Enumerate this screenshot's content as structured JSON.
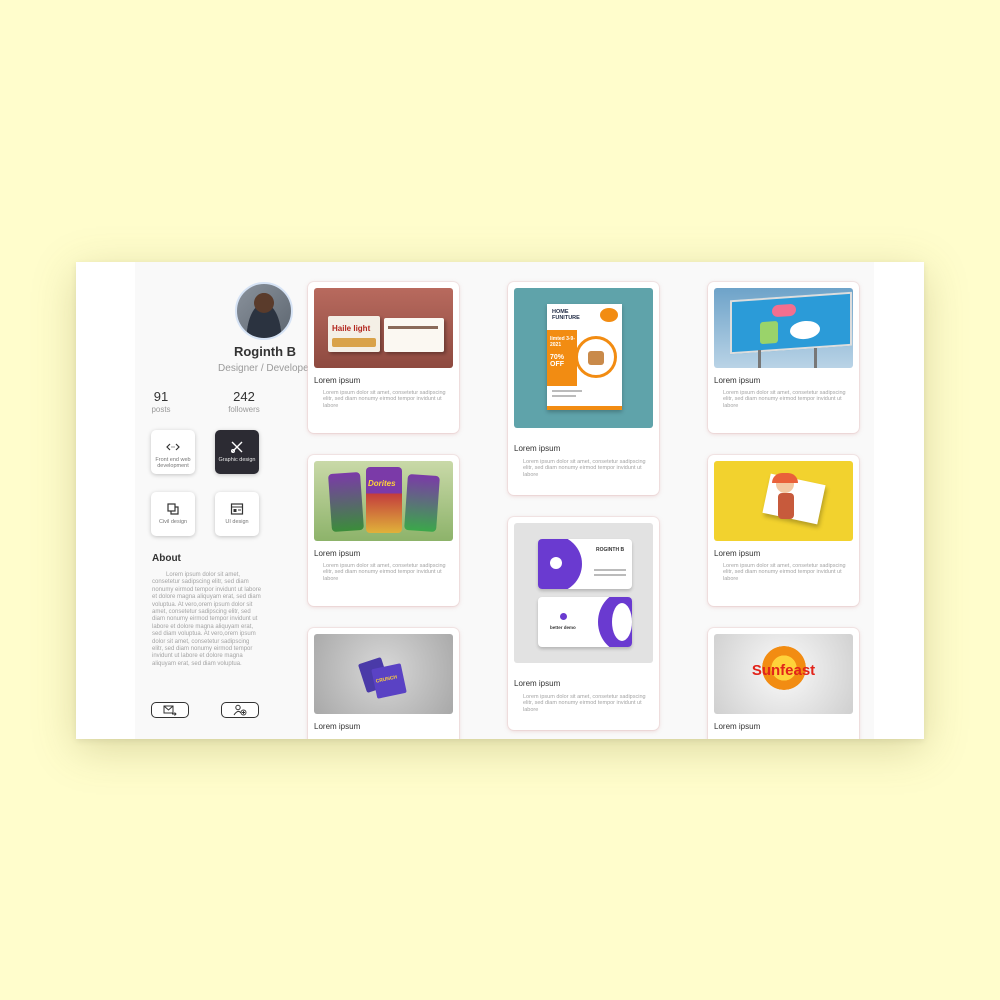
{
  "profile": {
    "name": "Roginth B",
    "role": "Designer / Developer",
    "posts_count": "91",
    "posts_label": "posts",
    "followers_count": "242",
    "followers_label": "followers"
  },
  "skills": [
    {
      "label": "Front end web development",
      "icon": "code-icon",
      "active": false
    },
    {
      "label": "Graphic design",
      "icon": "design-tools-icon",
      "active": true
    },
    {
      "label": "Civil design",
      "icon": "layers-icon",
      "active": false
    },
    {
      "label": "UI design",
      "icon": "window-layout-icon",
      "active": false
    }
  ],
  "about": {
    "heading": "About",
    "text": "Lorem ipsum dolor sit amet, consetetur sadipscing elitr, sed diam nonumy eirmod tempor invidunt ut labore et dolore magna aliquyam erat, sed diam voluptua. At vero,orem ipsum dolor sit amet, consetetur sadipscing elitr, sed diam nonumy eirmod tempor invidunt ut labore et dolore magna aliquyam erat, sed diam voluptua. At vero,orem ipsum dolor sit amet, consetetur sadipscing elitr, sed diam nonumy eirmod tempor invidunt ut labore et dolore magna aliquyam erat, sed diam voluptua."
  },
  "actions": [
    {
      "icon": "mail-send-icon"
    },
    {
      "icon": "add-user-icon"
    }
  ],
  "cards": [
    {
      "title": "Lorem ipsum",
      "desc": "Lorem ipsum dolor sit amet, consetetur sadipscing elitr, sed diam nonumy eirmod tempor invidunt ut labore",
      "image": "biscuit-box-packaging",
      "image_text": "Haile light"
    },
    {
      "title": "Lorem ipsum",
      "desc": "Lorem ipsum dolor sit amet, consetetur sadipscing elitr, sed diam nonumy eirmod tempor invidunt ut labore",
      "image": "chips-packets",
      "image_text": "Dorites"
    },
    {
      "title": "Lorem ipsum",
      "desc": "",
      "image": "chocolate-bar-mockup",
      "image_text": "CRUNCH"
    },
    {
      "title": "Lorem ipsum",
      "desc": "Lorem ipsum dolor sit amet, consetetur sadipscing elitr, sed diam nonumy eirmod tempor invidunt ut labore",
      "image": "furniture-flyer",
      "image_text": "HOME FUNITURE",
      "image_text2": "limted 3-9-2021",
      "image_text3": "70% OFF"
    },
    {
      "title": "Lorem ipsum",
      "desc": "Lorem ipsum dolor sit amet, consetetur sadipscing elitr, sed diam nonumy eirmod tempor invidunt ut labore",
      "image": "business-card",
      "image_text": "ROGINTH B",
      "image_text2": "better demo"
    },
    {
      "title": "Lorem ipsum",
      "desc": "Lorem ipsum dolor sit amet, consetetur sadipscing elitr, sed diam nonumy eirmod tempor invidunt ut labore",
      "image": "billboard"
    },
    {
      "title": "Lorem ipsum",
      "desc": "Lorem ipsum dolor sit amet, consetetur sadipscing elitr, sed diam nonumy eirmod tempor invidunt ut labore",
      "image": "character-illustration"
    },
    {
      "title": "Lorem ipsum",
      "desc": "",
      "image": "sunfeast-logo",
      "image_text": "Sunfeast"
    }
  ],
  "colors": {
    "page_bg": "#fffdcc",
    "active_skill": "#2c2b33",
    "flyer_orange": "#f28c12",
    "card_purple": "#6a3ad0",
    "billboard_blue": "#2b9bd8",
    "illustration_yellow": "#f2d22e",
    "sunfeast_red": "#e2231a"
  }
}
